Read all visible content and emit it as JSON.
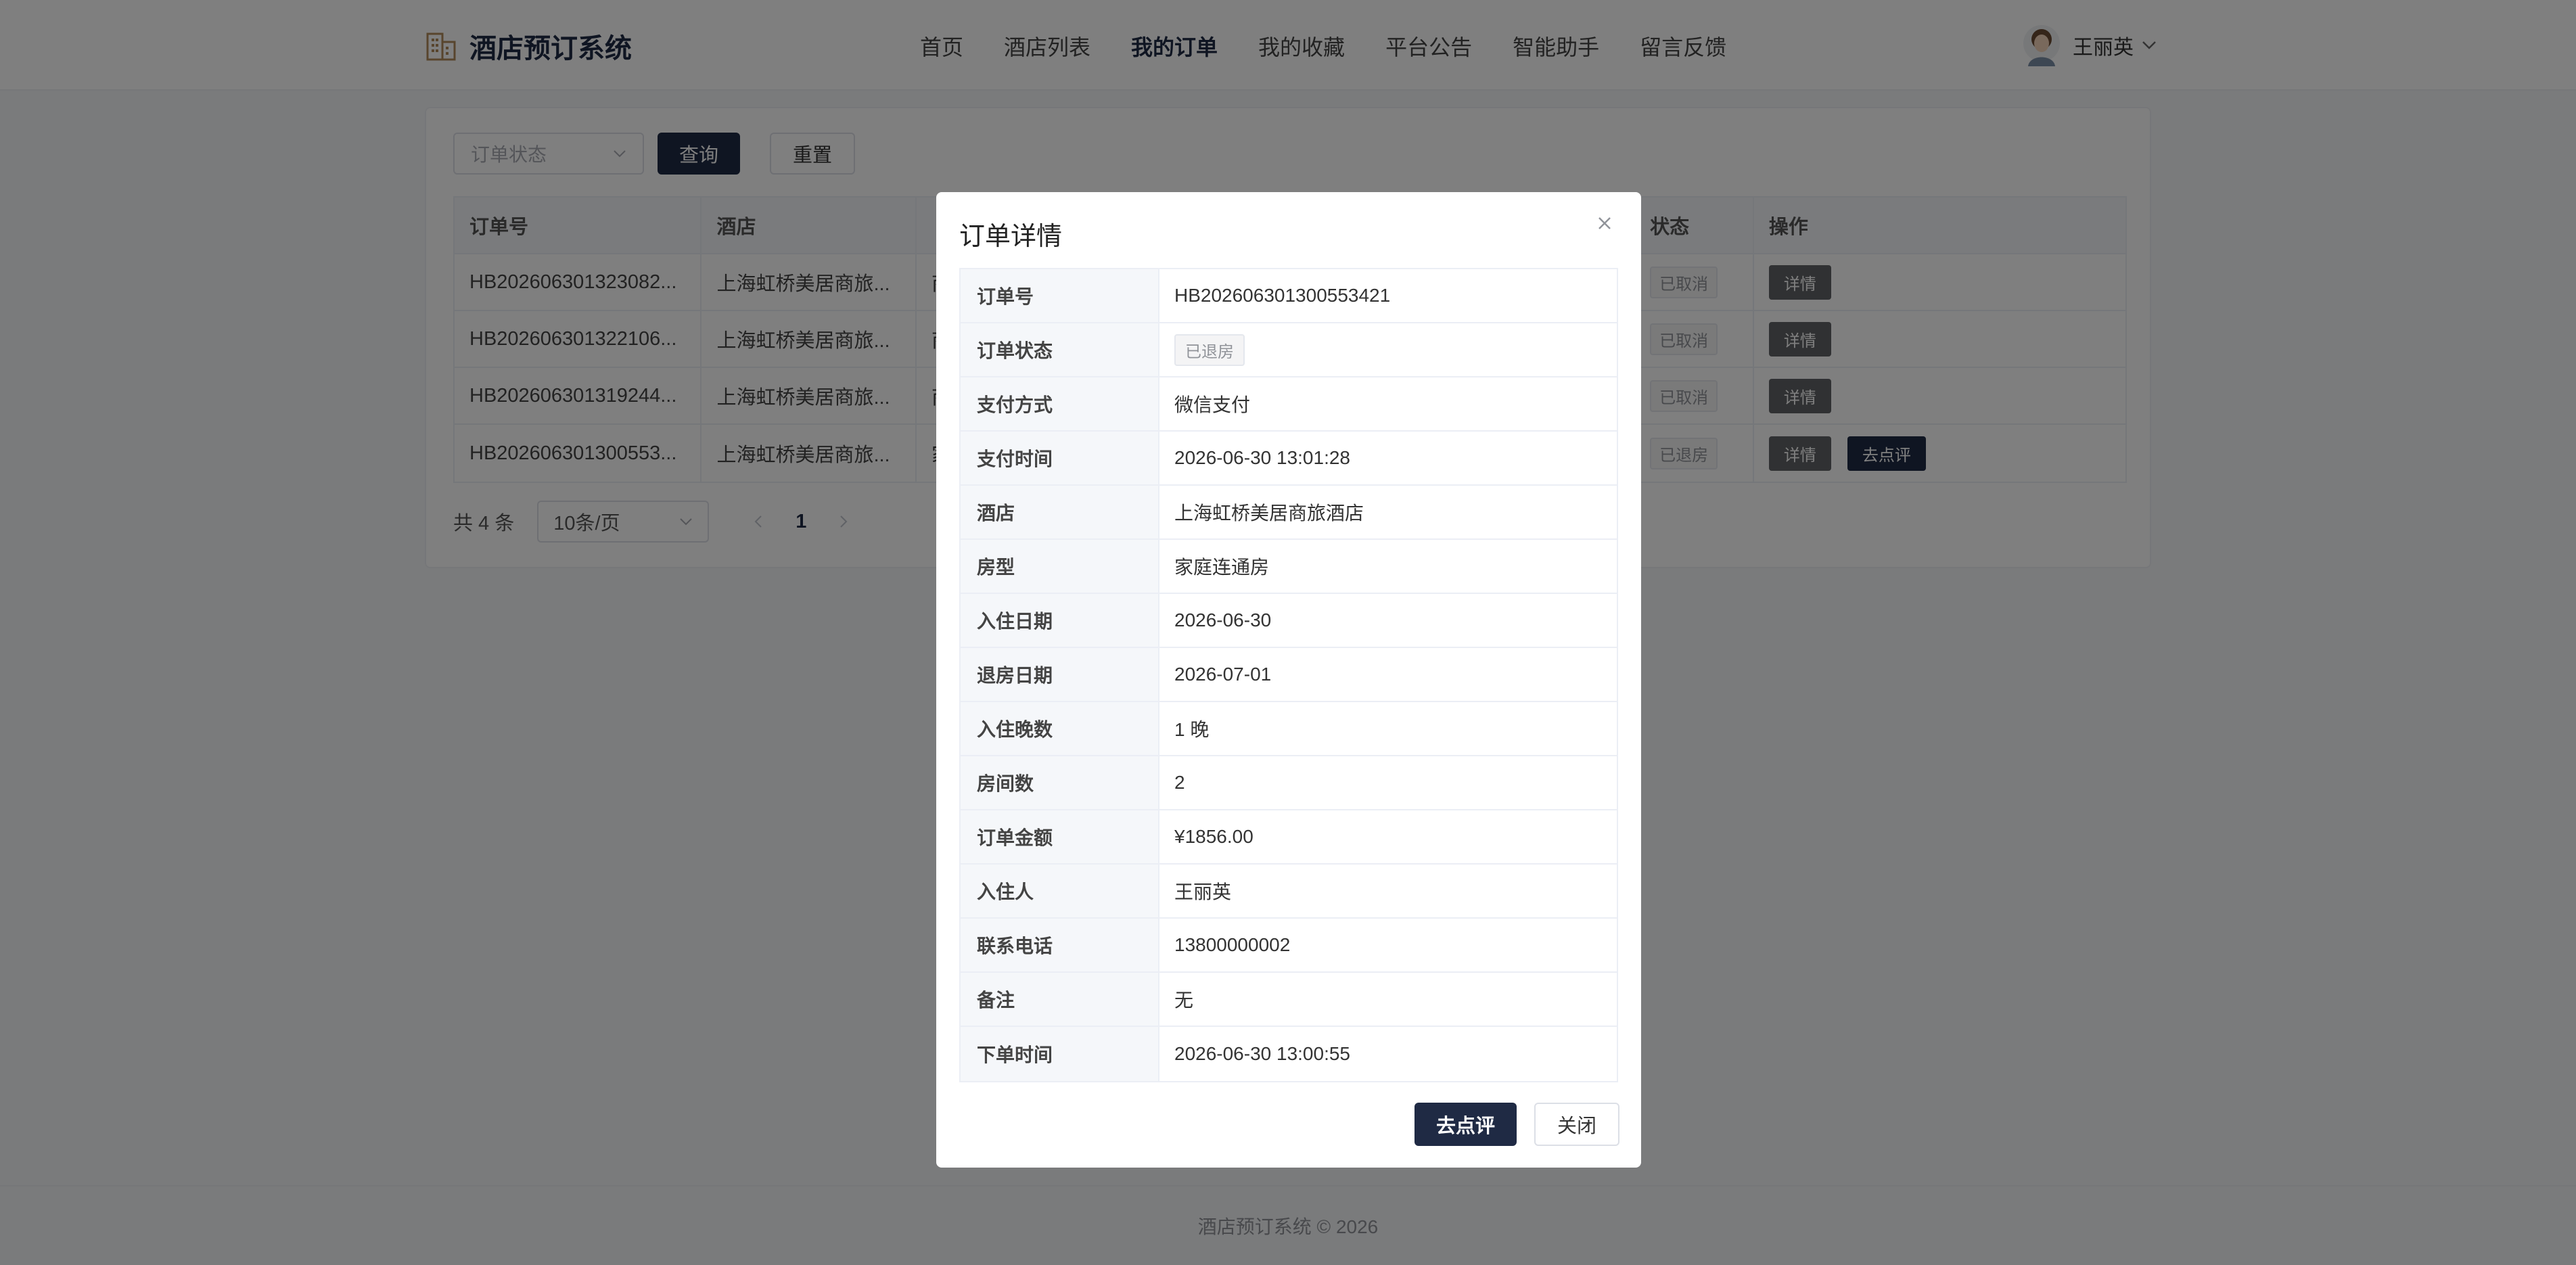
{
  "app": {
    "title": "酒店预订系统"
  },
  "nav": {
    "items": [
      "首页",
      "酒店列表",
      "我的订单",
      "我的收藏",
      "平台公告",
      "智能助手",
      "留言反馈"
    ],
    "active": "我的订单"
  },
  "user": {
    "name": "王丽英"
  },
  "filters": {
    "status_placeholder": "订单状态",
    "query_label": "查询",
    "reset_label": "重置"
  },
  "table": {
    "headers": [
      "订单号",
      "酒店",
      "",
      "状态",
      "操作"
    ],
    "rows": [
      {
        "order_no": "HB202606301323082...",
        "hotel": "上海虹桥美居商旅...",
        "room_prefix": "商",
        "status": "已取消",
        "actions": [
          "详情"
        ]
      },
      {
        "order_no": "HB202606301322106...",
        "hotel": "上海虹桥美居商旅...",
        "room_prefix": "商",
        "status": "已取消",
        "actions": [
          "详情"
        ]
      },
      {
        "order_no": "HB202606301319244...",
        "hotel": "上海虹桥美居商旅...",
        "room_prefix": "商",
        "status": "已取消",
        "actions": [
          "详情"
        ]
      },
      {
        "order_no": "HB202606301300553...",
        "hotel": "上海虹桥美居商旅...",
        "room_prefix": "家",
        "status": "已退房",
        "actions": [
          "详情",
          "去点评"
        ]
      }
    ]
  },
  "pagination": {
    "total_text": "共 4 条",
    "page_size": "10条/页",
    "current_page": "1"
  },
  "footer": {
    "text": "酒店预订系统 © 2026"
  },
  "dialog": {
    "title": "订单详情",
    "rows": [
      {
        "label": "订单号",
        "value": "HB202606301300553421"
      },
      {
        "label": "订单状态",
        "value": "已退房",
        "tag": true
      },
      {
        "label": "支付方式",
        "value": "微信支付"
      },
      {
        "label": "支付时间",
        "value": "2026-06-30 13:01:28"
      },
      {
        "label": "酒店",
        "value": "上海虹桥美居商旅酒店"
      },
      {
        "label": "房型",
        "value": "家庭连通房"
      },
      {
        "label": "入住日期",
        "value": "2026-06-30"
      },
      {
        "label": "退房日期",
        "value": "2026-07-01"
      },
      {
        "label": "入住晚数",
        "value": "1 晚"
      },
      {
        "label": "房间数",
        "value": "2"
      },
      {
        "label": "订单金额",
        "value": "¥1856.00"
      },
      {
        "label": "入住人",
        "value": "王丽英"
      },
      {
        "label": "联系电话",
        "value": "13800000002"
      },
      {
        "label": "备注",
        "value": "无"
      },
      {
        "label": "下单时间",
        "value": "2026-06-30 13:00:55"
      }
    ],
    "review_label": "去点评",
    "close_label": "关闭"
  },
  "colors": {
    "primary": "#1f2a44",
    "overlay": "rgba(0,0,0,0.5)"
  },
  "icons": [
    "building-icon",
    "avatar-image",
    "chevron-down-icon",
    "close-icon",
    "chevron-left-icon",
    "chevron-right-icon"
  ]
}
